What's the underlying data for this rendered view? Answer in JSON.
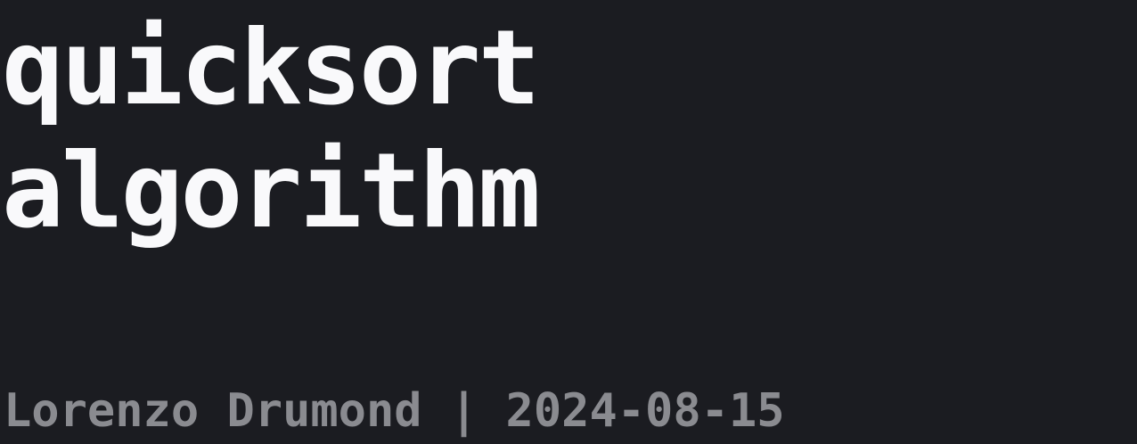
{
  "title": {
    "line1": "quicksort",
    "line2": "algorithm"
  },
  "byline": "Lorenzo Drumond | 2024-08-15",
  "colors": {
    "background": "#1b1c21",
    "title": "#f9f9fb",
    "byline": "#8a8b90"
  }
}
